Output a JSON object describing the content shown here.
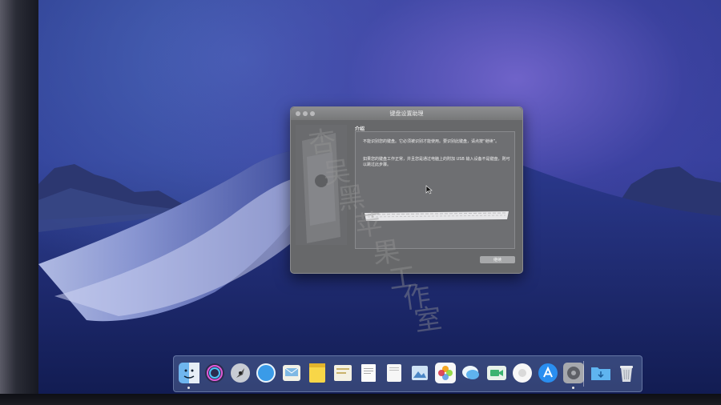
{
  "window": {
    "title": "键盘设置助理",
    "heading": "介绍",
    "para1": "不能识别您的键盘。它必须被识别才能使用。要识别此键盘，请点按“继续”。",
    "para2": "如果您的键盘工作正常，并且您是通过电脑上的附加 USB 输入设备不是键盘，则可以跳过此步骤。",
    "continue_label": "继续"
  },
  "watermark": [
    "杏",
    "吴",
    "黑",
    "苹",
    "果",
    "工",
    "作",
    "室"
  ],
  "dock": {
    "apps": [
      "finder-icon",
      "siri-icon",
      "launchpad-icon",
      "safari-icon",
      "mail-icon",
      "notes-icon",
      "stickies-icon",
      "textedit-icon",
      "pages-icon",
      "preview-icon",
      "photos-icon",
      "messages-icon",
      "facetime-icon",
      "photo-booth-icon",
      "app-store-icon",
      "system-preferences-icon",
      "downloads-folder-icon",
      "trash-icon"
    ]
  }
}
